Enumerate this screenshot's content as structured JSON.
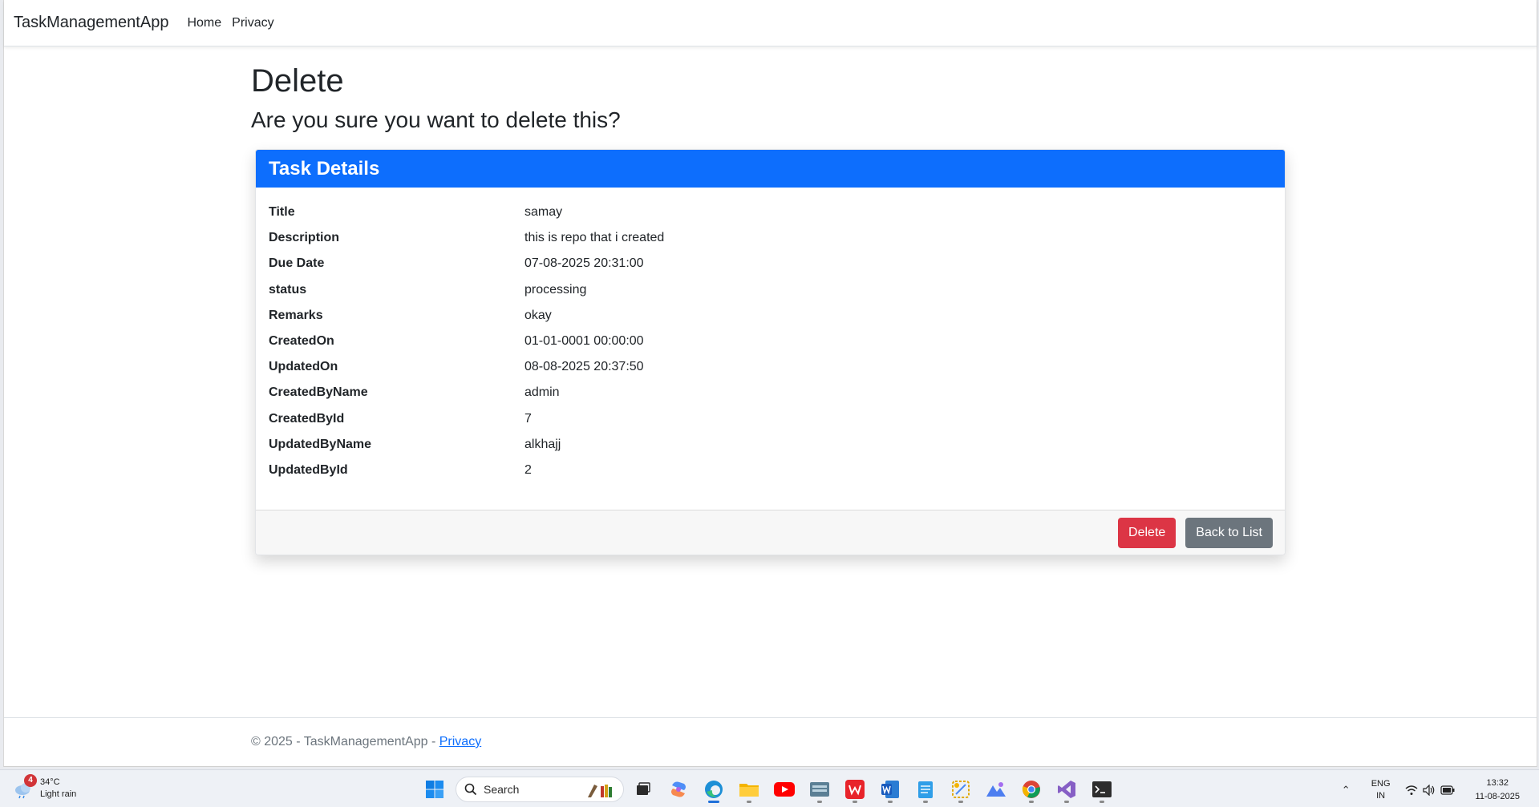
{
  "navbar": {
    "brand": "TaskManagementApp",
    "links": [
      "Home",
      "Privacy"
    ]
  },
  "page": {
    "title": "Delete",
    "subtitle": "Are you sure you want to delete this?"
  },
  "card": {
    "header": "Task Details",
    "rows": [
      {
        "label": "Title",
        "value": "samay"
      },
      {
        "label": "Description",
        "value": "this is repo that i created"
      },
      {
        "label": "Due Date",
        "value": "07-08-2025 20:31:00"
      },
      {
        "label": "status",
        "value": "processing"
      },
      {
        "label": "Remarks",
        "value": "okay"
      },
      {
        "label": "CreatedOn",
        "value": "01-01-0001 00:00:00"
      },
      {
        "label": "UpdatedOn",
        "value": "08-08-2025 20:37:50"
      },
      {
        "label": "CreatedByName",
        "value": "admin"
      },
      {
        "label": "CreatedById",
        "value": "7"
      },
      {
        "label": "UpdatedByName",
        "value": "alkhajj"
      },
      {
        "label": "UpdatedById",
        "value": "2"
      }
    ],
    "delete_label": "Delete",
    "back_label": "Back to List"
  },
  "footer": {
    "text": "© 2025 - TaskManagementApp - ",
    "link": "Privacy"
  },
  "taskbar": {
    "weather": {
      "badge": "4",
      "temp": "34°C",
      "condition": "Light rain"
    },
    "search_label": "Search",
    "apps": [
      "windows-start",
      "task-view",
      "copilot",
      "edge",
      "file-explorer",
      "youtube",
      "keyboard-app",
      "wps-office",
      "word",
      "notepad",
      "snipping-tool",
      "photos",
      "chrome",
      "visual-studio",
      "terminal"
    ],
    "lang": {
      "line1": "ENG",
      "line2": "IN"
    },
    "clock": {
      "time": "13:32",
      "date": "11-08-2025"
    }
  },
  "colors": {
    "primary": "#0d6efd",
    "danger": "#dc3545",
    "secondary": "#6c757d"
  }
}
